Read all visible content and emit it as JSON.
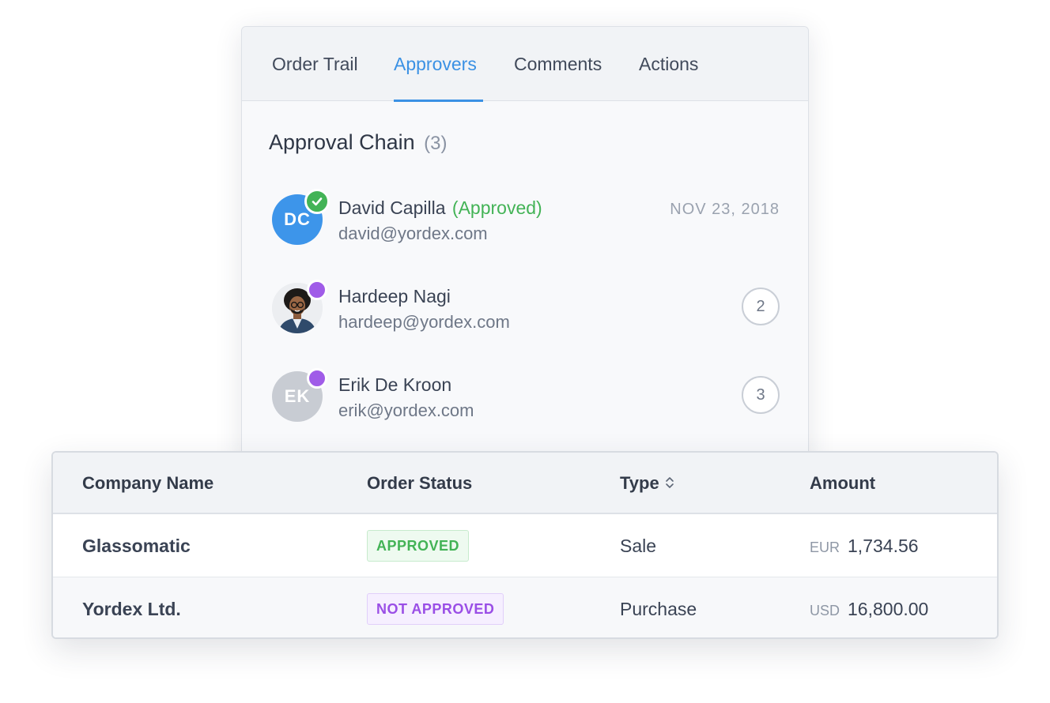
{
  "tabs": [
    {
      "label": "Order Trail",
      "active": false
    },
    {
      "label": "Approvers",
      "active": true
    },
    {
      "label": "Comments",
      "active": false
    },
    {
      "label": "Actions",
      "active": false
    }
  ],
  "approval_chain": {
    "title": "Approval Chain",
    "count": "(3)",
    "approvers": [
      {
        "initials": "DC",
        "name": "David Capilla",
        "status_label": "(Approved)",
        "email": "david@yordex.com",
        "date": "NOV 23, 2018",
        "status": "approved",
        "avatar_color": "#3d95ea"
      },
      {
        "name": "Hardeep Nagi",
        "email": "hardeep@yordex.com",
        "order": "2",
        "status": "pending",
        "avatar": "photo"
      },
      {
        "initials": "EK",
        "name": "Erik De Kroon",
        "email": "erik@yordex.com",
        "order": "3",
        "status": "pending",
        "avatar_color": "#c8ccd3"
      }
    ]
  },
  "table": {
    "columns": [
      "Company Name",
      "Order Status",
      "Type",
      "Amount"
    ],
    "rows": [
      {
        "company": "Glassomatic",
        "status": "APPROVED",
        "type": "Sale",
        "currency": "EUR",
        "amount": "1,734.56"
      },
      {
        "company": "Yordex Ltd.",
        "status": "NOT APPROVED",
        "type": "Purchase",
        "currency": "USD",
        "amount": "16,800.00"
      }
    ]
  },
  "colors": {
    "accent": "#3b91e4",
    "approved": "#43b356",
    "pending": "#a05ce8",
    "not_approved": "#9a4ee6"
  },
  "icons": {
    "approved_status": "check-icon",
    "pending_status": "pending-dot-icon",
    "sort": "sort-updown-icon"
  }
}
